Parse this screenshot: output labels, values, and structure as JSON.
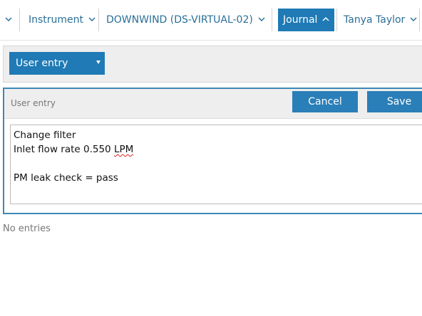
{
  "nav": {
    "items": [
      {
        "label": "",
        "active": false
      },
      {
        "label": "Instrument",
        "active": false
      },
      {
        "label": "DOWNWIND (DS-VIRTUAL-02)",
        "active": false
      },
      {
        "label": "Journal",
        "active": true
      },
      {
        "label": "Tanya Taylor",
        "active": false
      }
    ],
    "chevron_icon": "chevron-down-icon",
    "active_chevron_icon": "chevron-up-icon"
  },
  "selector": {
    "selected": "User entry"
  },
  "entry": {
    "title": "User entry",
    "cancel_label": "Cancel",
    "save_label": "Save",
    "text_lines": {
      "line1": "Change filter",
      "line2_prefix": "Inlet flow rate 0.550 ",
      "line2_unit": "LPM",
      "line3": "",
      "line4": "PM leak check = pass"
    }
  },
  "list": {
    "empty_message": "No entries"
  },
  "colors": {
    "accent": "#1f7ab5",
    "link": "#2a6f97",
    "panel_border": "#3d88b8"
  }
}
